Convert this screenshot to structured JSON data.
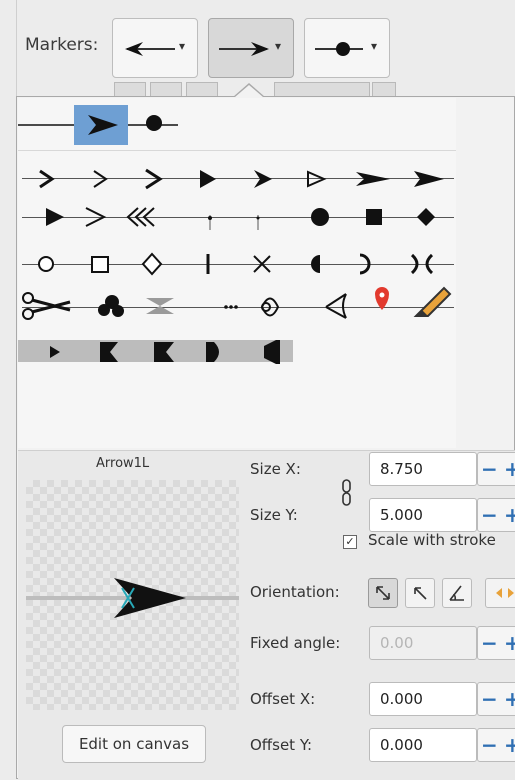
{
  "header": {
    "markers_label": "Markers:",
    "start_marker_chevron": "▾",
    "mid_marker_chevron": "▾",
    "end_marker_chevron": "▾"
  },
  "preview": {
    "marker_name": "Arrow1L",
    "edit_button_label": "Edit on canvas"
  },
  "properties": {
    "size_x_label": "Size X:",
    "size_x_value": "8.750",
    "size_y_label": "Size Y:",
    "size_y_value": "5.000",
    "scale_with_stroke_label": "Scale with stroke",
    "scale_with_stroke_checked": true,
    "orientation_label": "Orientation:",
    "fixed_angle_label": "Fixed angle:",
    "fixed_angle_value": "0.00",
    "offset_x_label": "Offset X:",
    "offset_x_value": "0.000",
    "offset_y_label": "Offset Y:",
    "offset_y_value": "0.000"
  },
  "icons": {
    "link": "chain-link-icon",
    "minus": "minus-icon",
    "plus": "plus-icon"
  },
  "colors": {
    "selection": "#6e9fd3",
    "spin_accent": "#2f6fb3",
    "location_pin": "#e23a2e",
    "pencil": "#e8a23a"
  }
}
